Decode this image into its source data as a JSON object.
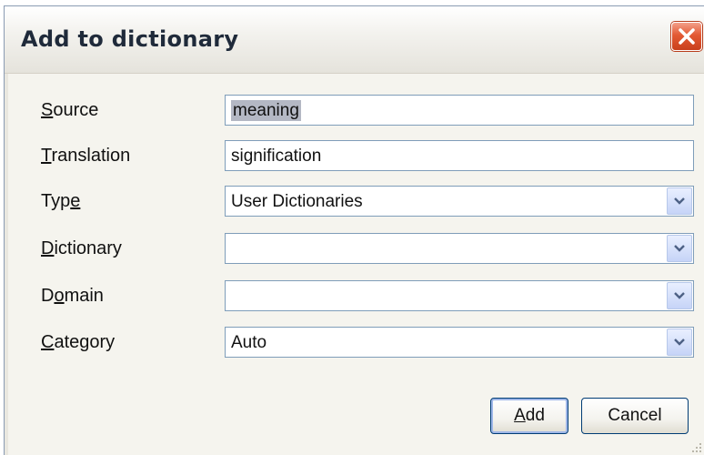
{
  "window": {
    "title": "Add to dictionary"
  },
  "form": {
    "source": {
      "label_underlined": "S",
      "label_rest": "ource",
      "value": "meaning"
    },
    "translation": {
      "label_underlined": "T",
      "label_rest": "ranslation",
      "value": "signification"
    },
    "type": {
      "label_pre": "Typ",
      "label_underlined": "e",
      "value": "User Dictionaries"
    },
    "dictionary": {
      "label_underlined": "D",
      "label_rest": "ictionary",
      "value": ""
    },
    "domain": {
      "label_pre": "D",
      "label_underlined": "o",
      "label_rest": "main",
      "value": ""
    },
    "category": {
      "label_underlined": "C",
      "label_rest": "ategory",
      "value": "Auto"
    }
  },
  "buttons": {
    "add_underlined": "A",
    "add_rest": "dd",
    "cancel": "Cancel"
  },
  "colors": {
    "close_button": "#e35a34",
    "field_border": "#7f9db9",
    "selection_highlight": "#b4b8c4"
  }
}
